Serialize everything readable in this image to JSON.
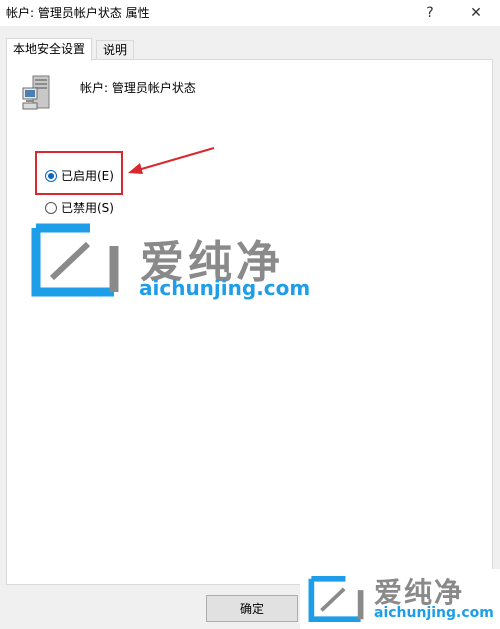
{
  "window": {
    "title": "帐户: 管理员帐户状态 属性",
    "help_glyph": "?",
    "close_glyph": "✕"
  },
  "tabs": [
    {
      "label": "本地安全设置",
      "active": true
    },
    {
      "label": "说明",
      "active": false
    }
  ],
  "policy": {
    "icon": "server-computer-icon",
    "name": "帐户: 管理员帐户状态"
  },
  "options": [
    {
      "label": "已启用(E)",
      "checked": true
    },
    {
      "label": "已禁用(S)",
      "checked": false
    }
  ],
  "annotation": {
    "highlight_color": "#d9282f",
    "arrow_color": "#d9282f"
  },
  "watermark": {
    "brand_cn": "爱纯净",
    "brand_url": "aichunjing.com",
    "brand_color": "#1e9ee8",
    "text_gray": "#8a8a8a"
  },
  "buttons": {
    "ok_label": "确定"
  }
}
